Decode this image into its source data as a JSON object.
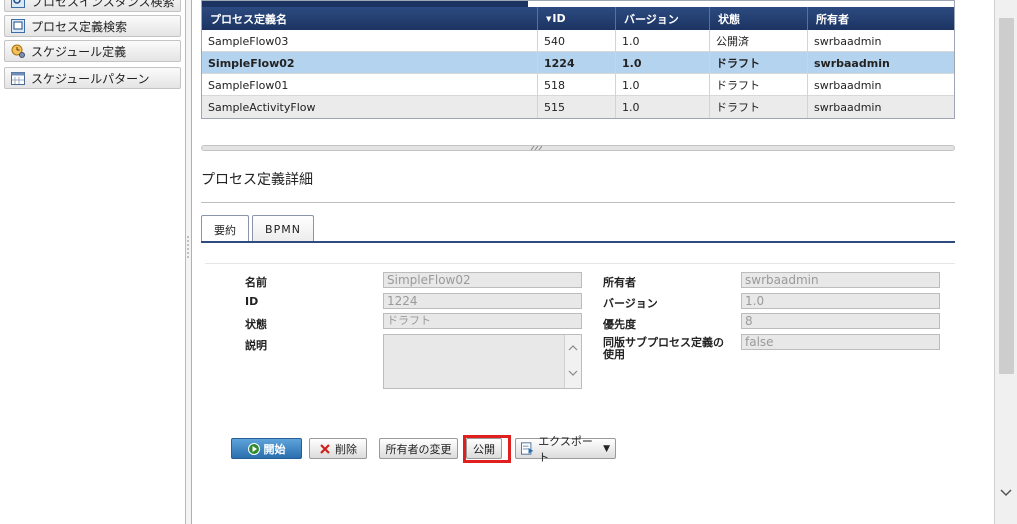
{
  "sidebar": {
    "items": [
      {
        "label": "プロセスインスタンス検索",
        "icon": "search-window-icon"
      },
      {
        "label": "プロセス定義検索",
        "icon": "search-window-icon"
      },
      {
        "label": "スケジュール定義",
        "icon": "clock-gear-icon"
      },
      {
        "label": "スケジュールパターン",
        "icon": "calendar-icon"
      }
    ]
  },
  "grid": {
    "columns": [
      "プロセス定義名",
      "ID",
      "バージョン",
      "状態",
      "所有者"
    ],
    "sort_indicator": "▼",
    "rows": [
      {
        "name": "SampleFlow03",
        "id": "540",
        "version": "1.0",
        "status": "公開済",
        "owner": "swrbaadmin"
      },
      {
        "name": "SimpleFlow02",
        "id": "1224",
        "version": "1.0",
        "status": "ドラフト",
        "owner": "swrbaadmin"
      },
      {
        "name": "SampleFlow01",
        "id": "518",
        "version": "1.0",
        "status": "ドラフト",
        "owner": "swrbaadmin"
      },
      {
        "name": "SampleActivityFlow",
        "id": "515",
        "version": "1.0",
        "status": "ドラフト",
        "owner": "swrbaadmin"
      }
    ],
    "selected_row": 1
  },
  "detail": {
    "title": "プロセス定義詳細",
    "tabs": [
      {
        "label": "要約"
      },
      {
        "label": "BPMN"
      }
    ],
    "fields": {
      "name_label": "名前",
      "name_value": "SimpleFlow02",
      "id_label": "ID",
      "id_value": "1224",
      "status_label": "状態",
      "status_value": "ドラフト",
      "desc_label": "説明",
      "owner_label": "所有者",
      "owner_value": "swrbaadmin",
      "version_label": "バージョン",
      "version_value": "1.0",
      "priority_label": "優先度",
      "priority_value": "8",
      "subprocess_label": "同版サブプロセス定義の使用",
      "subprocess_value": "false"
    },
    "buttons": {
      "start": "開始",
      "delete": "削除",
      "change_owner": "所有者の変更",
      "publish": "公開",
      "export": "エクスポート",
      "export_arrow": "▼"
    }
  },
  "colors": {
    "header_bg": "#1b3462",
    "selected_row": "#b4d3ef",
    "highlight": "#e01f1f",
    "primary_button": "#2a6fae"
  }
}
